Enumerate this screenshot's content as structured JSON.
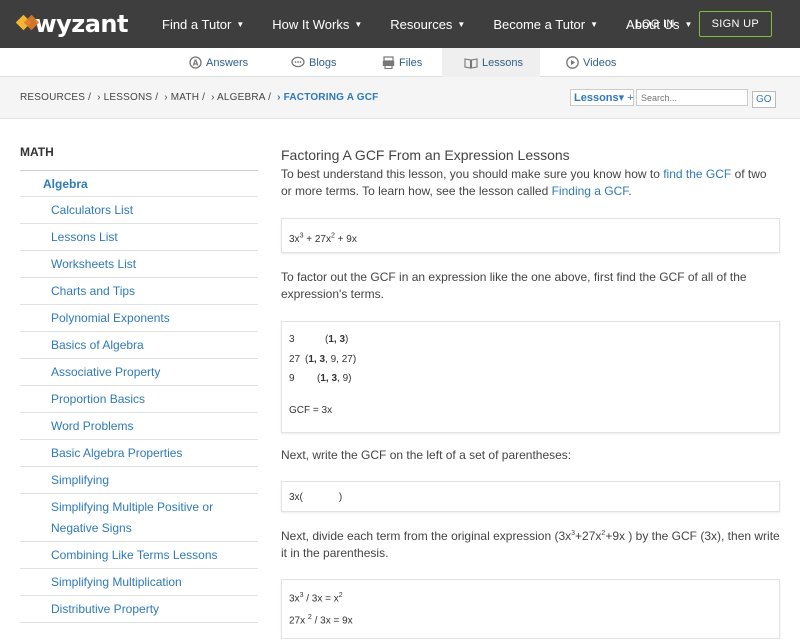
{
  "brand": {
    "name": "wyzant"
  },
  "topnav": {
    "items": [
      {
        "label": "Find a Tutor",
        "has_caret": true
      },
      {
        "label": "How It Works",
        "has_caret": true
      },
      {
        "label": "Resources",
        "has_caret": true
      },
      {
        "label": "Become a Tutor",
        "has_caret": true
      },
      {
        "label": "About Us",
        "has_caret": true
      }
    ],
    "login": "LOG IN",
    "signup": "SIGN UP",
    "caret": "▼"
  },
  "subnav": {
    "items": [
      {
        "label": "Answers",
        "icon": "answers-icon"
      },
      {
        "label": "Blogs",
        "icon": "blogs-icon"
      },
      {
        "label": "Files",
        "icon": "files-icon"
      },
      {
        "label": "Lessons",
        "icon": "lessons-icon",
        "active": true
      },
      {
        "label": "Videos",
        "icon": "videos-icon"
      }
    ]
  },
  "breadcrumb": {
    "items": [
      "RESOURCES /",
      "› LESSONS /",
      "› MATH /",
      "› ALGEBRA /",
      "› FACTORING A GCF"
    ]
  },
  "search": {
    "scope": "Lessons",
    "scope_caret": "▾",
    "scope_plus": "+",
    "placeholder": "Search...",
    "go": "GO"
  },
  "sidebar": {
    "heading": "MATH",
    "section": "Algebra",
    "items": [
      "Calculators List",
      "Lessons List",
      "Worksheets List",
      "Charts and Tips",
      "Polynomial Exponents",
      "Basics of Algebra",
      "Associative Property",
      "Proportion Basics",
      "Word Problems",
      "Basic Algebra Properties",
      "Simplifying",
      "Simplifying Multiple Positive or Negative Signs",
      "Combining Like Terms Lessons",
      "Simplifying Multiplication",
      "Distributive Property"
    ]
  },
  "lesson": {
    "title": "Factoring A GCF From an Expression Lessons",
    "intro_1": "To best understand this lesson, you should make sure you know how to ",
    "intro_link_1": "find the GCF",
    "intro_2": " of two or more terms. To learn how, see the lesson called ",
    "intro_link_2": "Finding a GCF",
    "intro_3": ".",
    "expr": {
      "a": "3x",
      "a_exp": "3",
      "b": " + 27x",
      "b_exp": "2",
      "c": " + 9x"
    },
    "step1": "To factor out the GCF in an expression like the one above, first find the GCF of all of the expression's terms.",
    "gcf_rows": [
      {
        "n": "3",
        "factors_pre": "(",
        "factors_bold": "1, 3",
        "factors_post": ")"
      },
      {
        "n": "27",
        "factors_pre": "(",
        "factors_bold": "1, 3",
        "factors_post": ", 9, 27)"
      },
      {
        "n": "9",
        "factors_pre": "(",
        "factors_bold": "1, 3",
        "factors_post": ", 9)"
      }
    ],
    "gcf_result": "GCF = 3x",
    "step2": "Next, write the GCF on the left of a set of parentheses:",
    "paren": {
      "open": "3x(",
      "close": ")"
    },
    "step3_a": "Next, divide each term from the original expression (3x",
    "step3_a_exp": "3",
    "step3_b": "+27x",
    "step3_b_exp": "2",
    "step3_c": "+9x ) by the GCF (3x), then write it in the parenthesis.",
    "div_rows": [
      {
        "lhs": "3x",
        "lhs_exp": "3",
        "mid": " / 3x = x",
        "rhs_exp": "2"
      },
      {
        "lhs": "27x ",
        "lhs_exp": "2",
        "mid": " / 3x = 9x",
        "rhs_exp": ""
      }
    ]
  }
}
